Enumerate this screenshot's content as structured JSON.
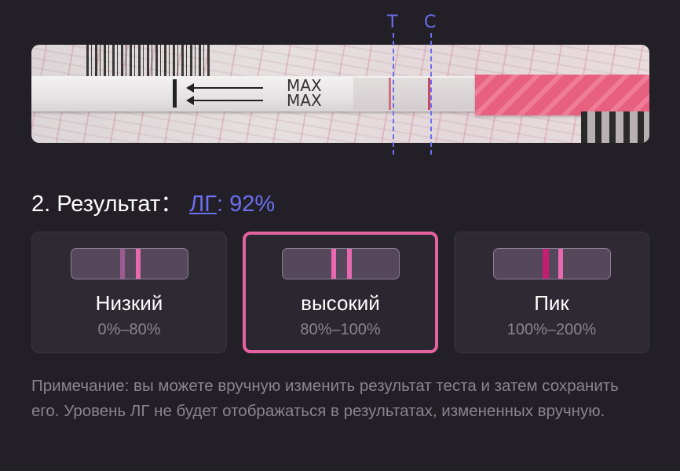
{
  "markers": {
    "t_label": "T",
    "c_label": "C"
  },
  "photo": {
    "strip_text_1": "MAX",
    "strip_text_2": "MAX"
  },
  "result": {
    "prefix": "2. Результат：",
    "lh_label": "ЛГ",
    "value": ": 92%"
  },
  "levels": [
    {
      "name": "Низкий",
      "range": "0%–80%",
      "selected": false
    },
    {
      "name": "высокий",
      "range": "80%–100%",
      "selected": true
    },
    {
      "name": "Пик",
      "range": "100%–200%",
      "selected": false
    }
  ],
  "note": "Примечание: вы можете вручную изменить результат теста и затем сохранить его. Уровень ЛГ не будет отображаться в результатах, измененных вручную.",
  "colors": {
    "background": "#221f26",
    "accent_blue": "#6b6ff0",
    "accent_pink": "#e562a0",
    "muted_text": "#8a8390"
  }
}
